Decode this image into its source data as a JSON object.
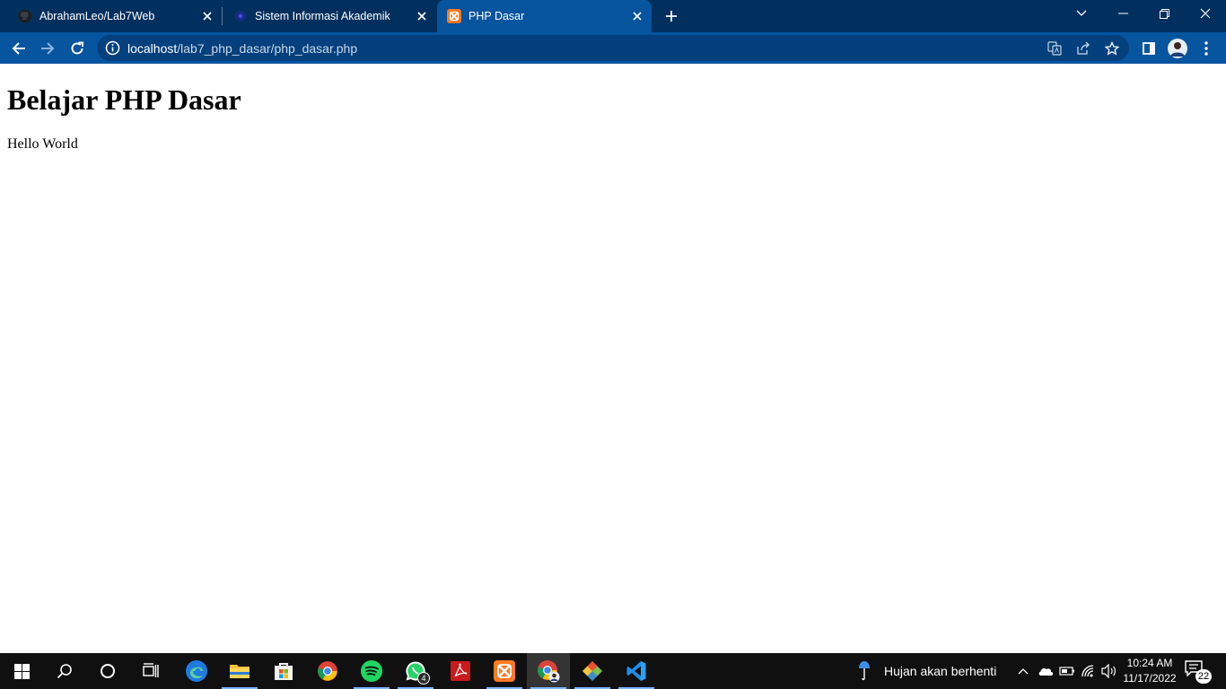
{
  "browser": {
    "tabs": [
      {
        "title": "AbrahamLeo/Lab7Web",
        "favicon": "github-icon"
      },
      {
        "title": "Sistem Informasi Akademik",
        "favicon": "site-icon"
      },
      {
        "title": "PHP Dasar",
        "favicon": "xampp-icon",
        "active": true
      }
    ],
    "address_bar": {
      "host": "localhost",
      "path": "/lab7_php_dasar/php_dasar.php"
    }
  },
  "page": {
    "heading": "Belajar PHP Dasar",
    "text": "Hello World"
  },
  "taskbar": {
    "apps": [
      "start-icon",
      "search-icon",
      "cortana-icon",
      "task-view-icon",
      "edge-icon",
      "file-explorer-icon",
      "store-icon",
      "chrome-icon",
      "spotify-icon",
      "whatsapp-icon",
      "acrobat-icon",
      "xampp-icon",
      "chrome-profile-icon",
      "git-icon",
      "vscode-icon"
    ],
    "whatsapp_badge": "4",
    "weather": "Hujan akan berhenti",
    "time": "10:24 AM",
    "date": "11/17/2022",
    "notification_count": "22"
  },
  "colors": {
    "tabstrip": "#02305e",
    "toolbar": "#07549f",
    "omnibox": "#04407d",
    "taskbar": "#101010"
  }
}
